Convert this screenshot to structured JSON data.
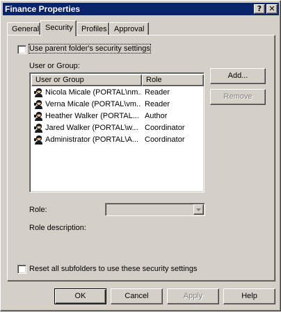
{
  "window": {
    "title": "Finance Properties",
    "help_glyph": "?",
    "close_glyph": "✕"
  },
  "tabs": [
    {
      "label": "General",
      "active": false
    },
    {
      "label": "Security",
      "active": true
    },
    {
      "label": "Profiles",
      "active": false
    },
    {
      "label": "Approval",
      "active": false
    }
  ],
  "security": {
    "use_parent_label": "Use parent folder's security settings",
    "use_parent_checked": false,
    "user_or_group_label": "User or Group:",
    "columns": [
      "User or Group",
      "Role"
    ],
    "rows": [
      {
        "name": "Nicola Micale (PORTAL\\nm...",
        "role": "Reader",
        "icon": "user-icon"
      },
      {
        "name": "Verna Micale (PORTAL\\vm...",
        "role": "Reader",
        "icon": "user-icon"
      },
      {
        "name": "Heather Walker (PORTAL...",
        "role": "Author",
        "icon": "user-icon"
      },
      {
        "name": "Jared Walker (PORTAL\\w...",
        "role": "Coordinator",
        "icon": "user-icon"
      },
      {
        "name": "Administrator (PORTAL\\A...",
        "role": "Coordinator",
        "icon": "user-icon"
      }
    ],
    "add_button": "Add...",
    "remove_button": "Remove",
    "role_label": "Role:",
    "role_value": "",
    "role_description_label": "Role description:",
    "reset_subfolders_label": "Reset all subfolders to use these security settings",
    "reset_subfolders_checked": false
  },
  "footer": {
    "ok": "OK",
    "cancel": "Cancel",
    "apply": "Apply",
    "help": "Help"
  },
  "colors": {
    "titlebar": "#0a246a",
    "face": "#d4d0c8",
    "disabled_text": "#808080"
  }
}
